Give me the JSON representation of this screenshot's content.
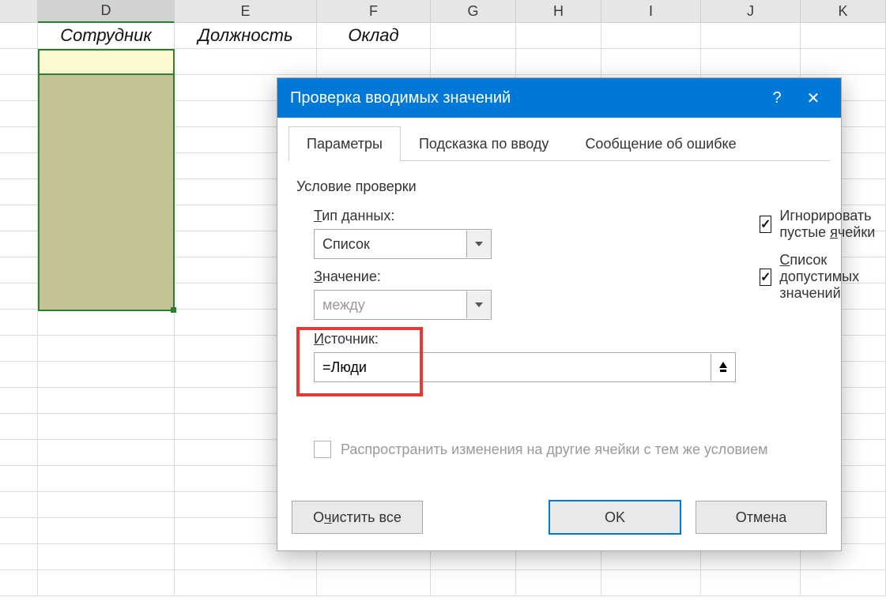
{
  "grid": {
    "columns": [
      "D",
      "E",
      "F",
      "G",
      "H",
      "I",
      "J",
      "K"
    ],
    "header_row": {
      "D": "Сотрудник",
      "E": "Должность",
      "F": "Оклад"
    },
    "selected_column": "D"
  },
  "dialog": {
    "title": "Проверка вводимых значений",
    "tabs": {
      "params": "Параметры",
      "hint": "Подсказка по вводу",
      "error": "Сообщение об ошибке",
      "active": "params"
    },
    "section_title": "Условие проверки",
    "type_label": "Тип данных:",
    "type_value": "Список",
    "value_label": "Значение:",
    "value_value": "между",
    "check_ignore_blank": "Игнорировать пустые ячейки",
    "check_list_dropdown": "Список допустимых значений",
    "source_label": "Источник:",
    "source_value": "=Люди",
    "spread_label": "Распространить изменения на другие ячейки с тем же условием",
    "buttons": {
      "clear": "Очистить все",
      "ok": "OK",
      "cancel": "Отмена"
    },
    "help_glyph": "?",
    "close_glyph": "✕",
    "mnemonics": {
      "type": "Т",
      "value": "З",
      "ignore": "я",
      "list": "С",
      "source": "И",
      "clear": "ч"
    }
  }
}
